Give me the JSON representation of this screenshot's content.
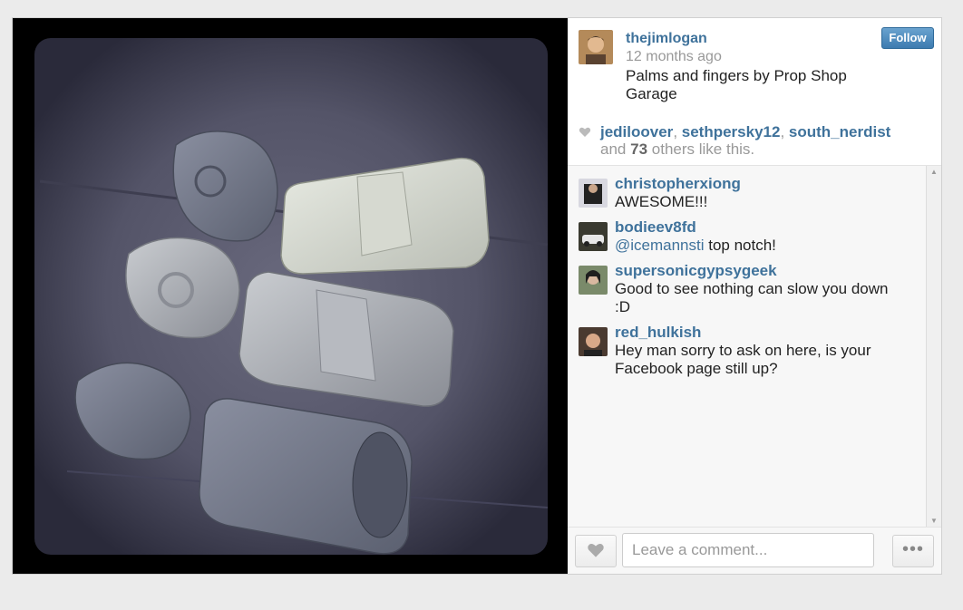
{
  "post": {
    "username": "thejimlogan",
    "time_ago": "12 months ago",
    "caption": "Palms and fingers by Prop Shop Garage",
    "follow_label": "Follow",
    "photo_icon": "photo-of-armor-pieces"
  },
  "likes": {
    "names": [
      "jediloover",
      "sethpersky12",
      "south_nerdist"
    ],
    "prefix": "and",
    "count": "73",
    "suffix": "others like this."
  },
  "comments": [
    {
      "user": "christopherxiong",
      "text": "AWESOME!!!"
    },
    {
      "user": "bodieev8fd",
      "mention": "@icemannsti",
      "text": " top notch!"
    },
    {
      "user": "supersonicgypsygeek",
      "text": "Good to see nothing can slow you down :D"
    },
    {
      "user": "red_hulkish",
      "text": "Hey man sorry to ask on here, is your Facebook page still up?"
    }
  ],
  "footer": {
    "comment_placeholder": "Leave a comment...",
    "more_label": "•••"
  },
  "colors": {
    "link": "#3f729b",
    "follow_button": "#4b8bbe",
    "background": "#ebebeb"
  }
}
